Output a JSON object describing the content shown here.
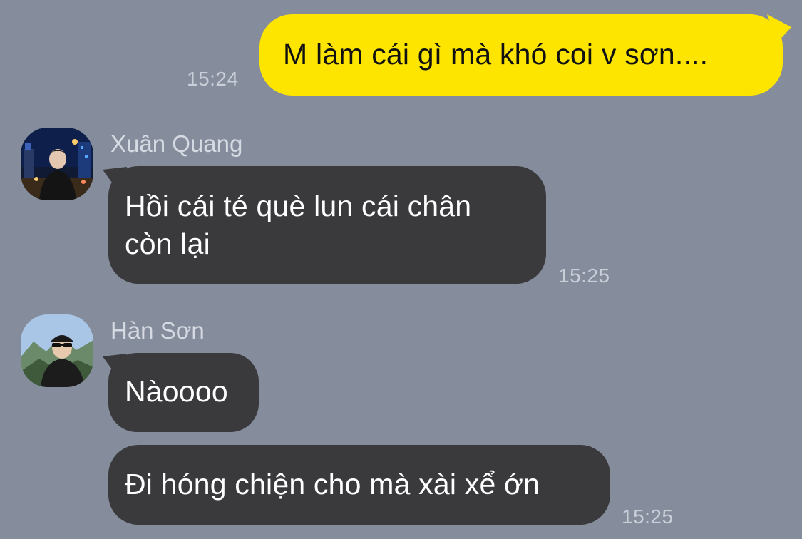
{
  "messages": [
    {
      "direction": "outgoing",
      "text": "M làm cái gì mà khó coi v sơn....",
      "time": "15:24"
    },
    {
      "direction": "incoming",
      "sender": "Xuân Quang",
      "avatar_icon": "profile-photo-night-city",
      "text_lines": [
        "Hồi cái té què lun cái chân",
        "còn lại"
      ],
      "time": "15:25"
    },
    {
      "direction": "incoming",
      "sender": "Hàn Sơn",
      "avatar_icon": "profile-photo-sunglasses-mountain",
      "bubbles": [
        "Nàoooo",
        "Đi hóng chiện cho mà xài xể ớn"
      ],
      "time": "15:25"
    }
  ],
  "colors": {
    "background": "#858c9b",
    "outgoing_bubble": "#fde500",
    "incoming_bubble": "#3a3a3d",
    "timestamp": "#c9ced8",
    "sender_name": "#d6dae2"
  }
}
